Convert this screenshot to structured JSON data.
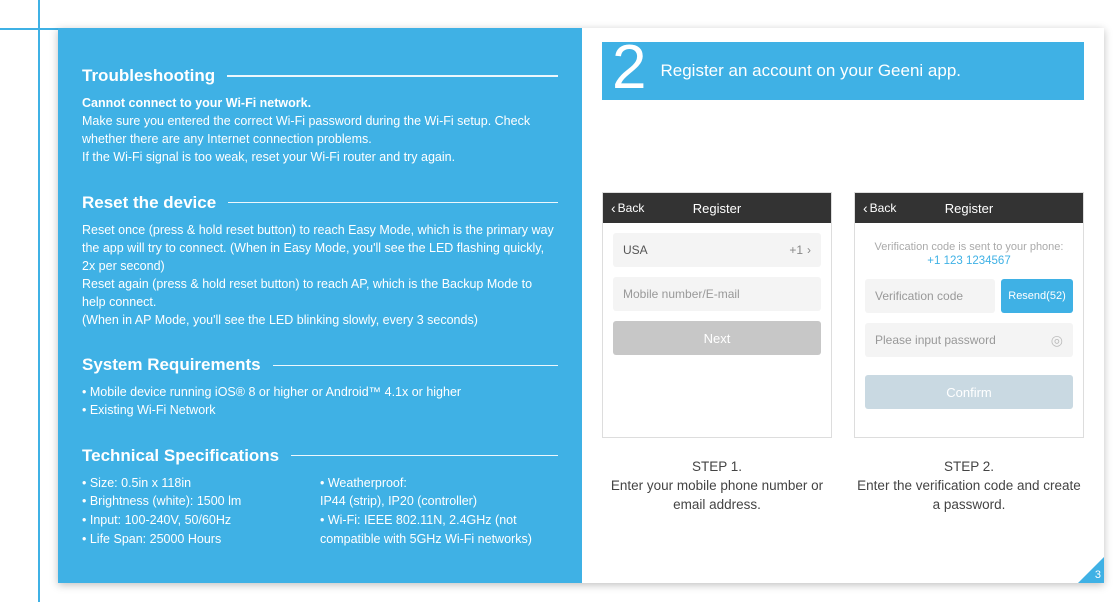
{
  "left": {
    "troubleshooting": {
      "title": "Troubleshooting",
      "bold": "Cannot connect to your Wi-Fi network.",
      "line1": "Make sure you entered the correct Wi-Fi password during the Wi-Fi setup. Check whether there are any Internet connection problems.",
      "line2": "If the Wi-Fi signal is too weak, reset your Wi-Fi router and try again."
    },
    "reset": {
      "title": "Reset the device",
      "p1": "Reset once (press & hold reset button) to reach Easy Mode, which is the primary way the app will try to connect. (When in Easy Mode, you'll see the LED flashing quickly, 2x per second)",
      "p2": "Reset again (press & hold reset button) to reach AP, which is the Backup Mode to help connect.",
      "p3": "(When in AP Mode, you'll see the LED blinking slowly, every 3 seconds)"
    },
    "sysreq": {
      "title": "System Requirements",
      "b1": "• Mobile device running iOS® 8 or higher or Android™ 4.1x or higher",
      "b2": "• Existing Wi-Fi Network"
    },
    "specs": {
      "title": "Technical Specifications",
      "c1l1": "• Size: 0.5in x 118in",
      "c1l2": "• Brightness (white): 1500 lm",
      "c1l3": "• Input: 100-240V, 50/60Hz",
      "c1l4": "• Life Span: 25000 Hours",
      "c2l1": "• Weatherproof:",
      "c2l2": "IP44 (strip), IP20 (controller)",
      "c2l3": "• Wi-Fi: IEEE 802.11N, 2.4GHz   (not compatible with 5GHz Wi-Fi networks)"
    }
  },
  "right": {
    "step_num": "2",
    "step_text": "Register an account on your Geeni app.",
    "screen1": {
      "back": "Back",
      "title": "Register",
      "country": "USA",
      "dial": "+1",
      "input_ph": "Mobile number/E-mail",
      "next": "Next"
    },
    "screen2": {
      "back": "Back",
      "title": "Register",
      "note": "Verification code is sent to your phone:",
      "phone": "+1 123 1234567",
      "ver_ph": "Verification code",
      "resend": "Resend(52)",
      "pwd_ph": "Please input password",
      "confirm": "Confirm"
    },
    "cap1_lbl": "STEP 1.",
    "cap1_txt": "Enter your mobile phone number or email address.",
    "cap2_lbl": "STEP 2.",
    "cap2_txt": "Enter the verification code and create a password.",
    "page_num": "3"
  }
}
